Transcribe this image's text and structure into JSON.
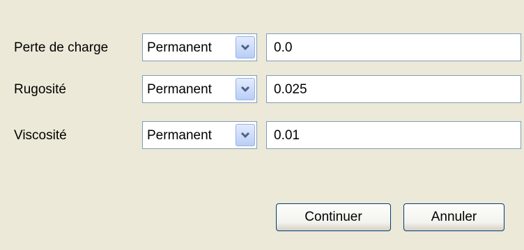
{
  "rows": [
    {
      "label": "Perte de charge",
      "mode": "Permanent",
      "value": "0.0"
    },
    {
      "label": "Rugosité",
      "mode": "Permanent",
      "value": "0.025"
    },
    {
      "label": "Viscosité",
      "mode": "Permanent",
      "value": "0.01"
    }
  ],
  "buttons": {
    "continue": "Continuer",
    "cancel": "Annuler"
  },
  "colors": {
    "background": "#ece9d8",
    "field_border": "#7f9db9",
    "button_border": "#003c74",
    "dropdown_arrow": "#4d6185"
  },
  "icons": {
    "dropdown": "chevron-down-icon"
  }
}
